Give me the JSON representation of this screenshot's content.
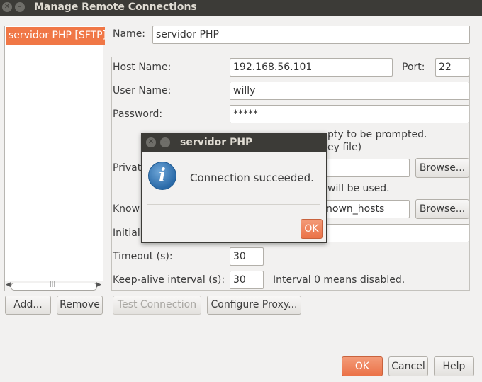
{
  "window": {
    "title": "Manage Remote Connections",
    "close_glyph": "✕",
    "minimize_glyph": "–"
  },
  "connections": {
    "items": [
      {
        "label": "servidor PHP [SFTP]"
      }
    ],
    "add_label": "Add...",
    "remove_label": "Remove",
    "scroll_left": "◀",
    "scroll_right": "▶",
    "scroll_grip": "|||"
  },
  "form": {
    "name_label": "Name:",
    "name_value": "servidor PHP",
    "host_label": "Host Name:",
    "host_value": "192.168.56.101",
    "port_label": "Port:",
    "port_value": "22",
    "user_label": "User Name:",
    "user_value": "willy",
    "password_label": "Password:",
    "password_value": "*****",
    "password_hint_line1": "pty to be prompted.",
    "password_hint_line2": "ey file)",
    "private_label": "Privat",
    "private_value": "",
    "private_browse": "Browse...",
    "private_hint": "will be used.",
    "known_label": "Know",
    "known_value": "nown_hosts",
    "known_browse": "Browse...",
    "initial_label": "Initial",
    "initial_value": "",
    "timeout_label": "Timeout (s):",
    "timeout_value": "30",
    "keepalive_label": "Keep-alive interval (s):",
    "keepalive_value": "30",
    "keepalive_hint": "Interval 0 means disabled."
  },
  "actions": {
    "test_label": "Test Connection",
    "proxy_label": "Configure Proxy...",
    "ok_label": "OK",
    "cancel_label": "Cancel",
    "help_label": "Help"
  },
  "dialog": {
    "title": "servidor PHP",
    "message": "Connection succeeded.",
    "ok_label": "OK",
    "icon": "info-icon"
  }
}
